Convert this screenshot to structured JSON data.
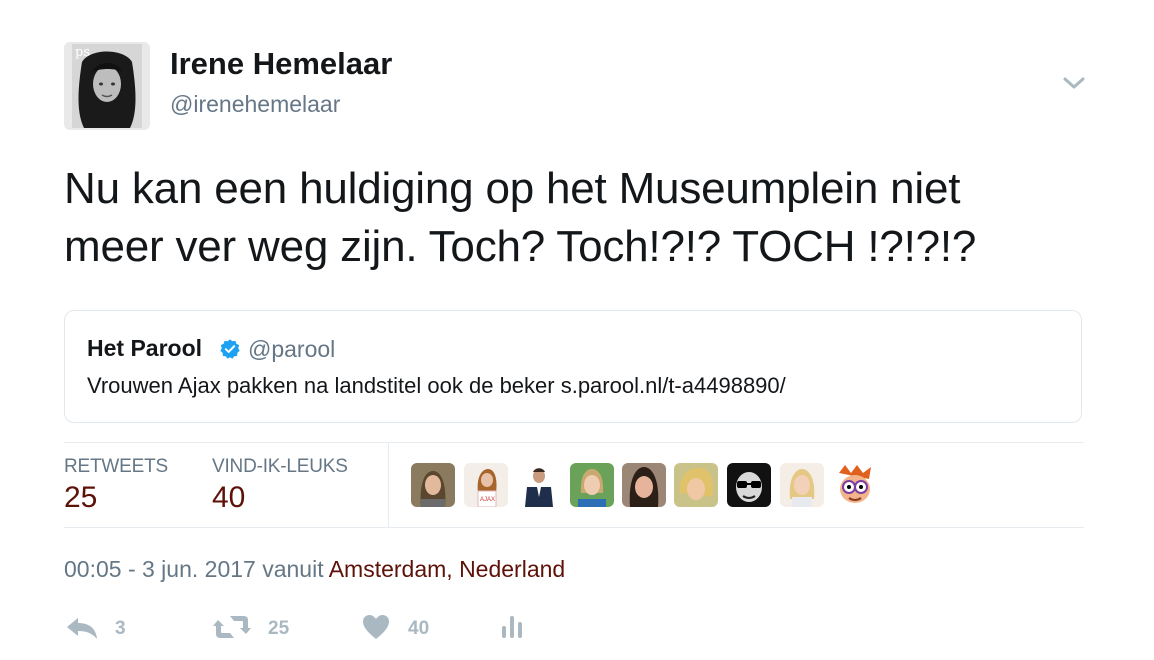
{
  "author": {
    "name": "Irene Hemelaar",
    "handle": "@irenehemelaar",
    "avatar_text": "ps"
  },
  "tweet": {
    "line1": "Nu kan een huldiging op het Museumplein niet",
    "line2": "meer ver weg zijn. Toch? Toch!?!? TOCH !?!?!?"
  },
  "quote": {
    "name": "Het Parool",
    "handle": "@parool",
    "verified": true,
    "text": "Vrouwen Ajax pakken na landstitel ook de beker s.parool.nl/t-a4498890/"
  },
  "stats": {
    "retweets_label": "RETWEETS",
    "retweets_value": "25",
    "likes_label": "VIND-IK-LEUKS",
    "likes_value": "40"
  },
  "meta": {
    "time_prefix": "00:05 - 3 jun. 2017 vanuit ",
    "location": "Amsterdam, Nederland"
  },
  "actions": {
    "reply_count": "3",
    "retweet_count": "25",
    "like_count": "40"
  },
  "colors": {
    "text": "#14171a",
    "secondary": "#657786",
    "stat_value": "#5e1108",
    "action_gray": "#aab8c2",
    "verified_blue": "#1da1f2",
    "border": "#e1e8ed"
  },
  "icons": [
    "chevron-down-icon",
    "verified-badge-icon",
    "reply-icon",
    "retweet-icon",
    "heart-icon",
    "analytics-icon"
  ]
}
